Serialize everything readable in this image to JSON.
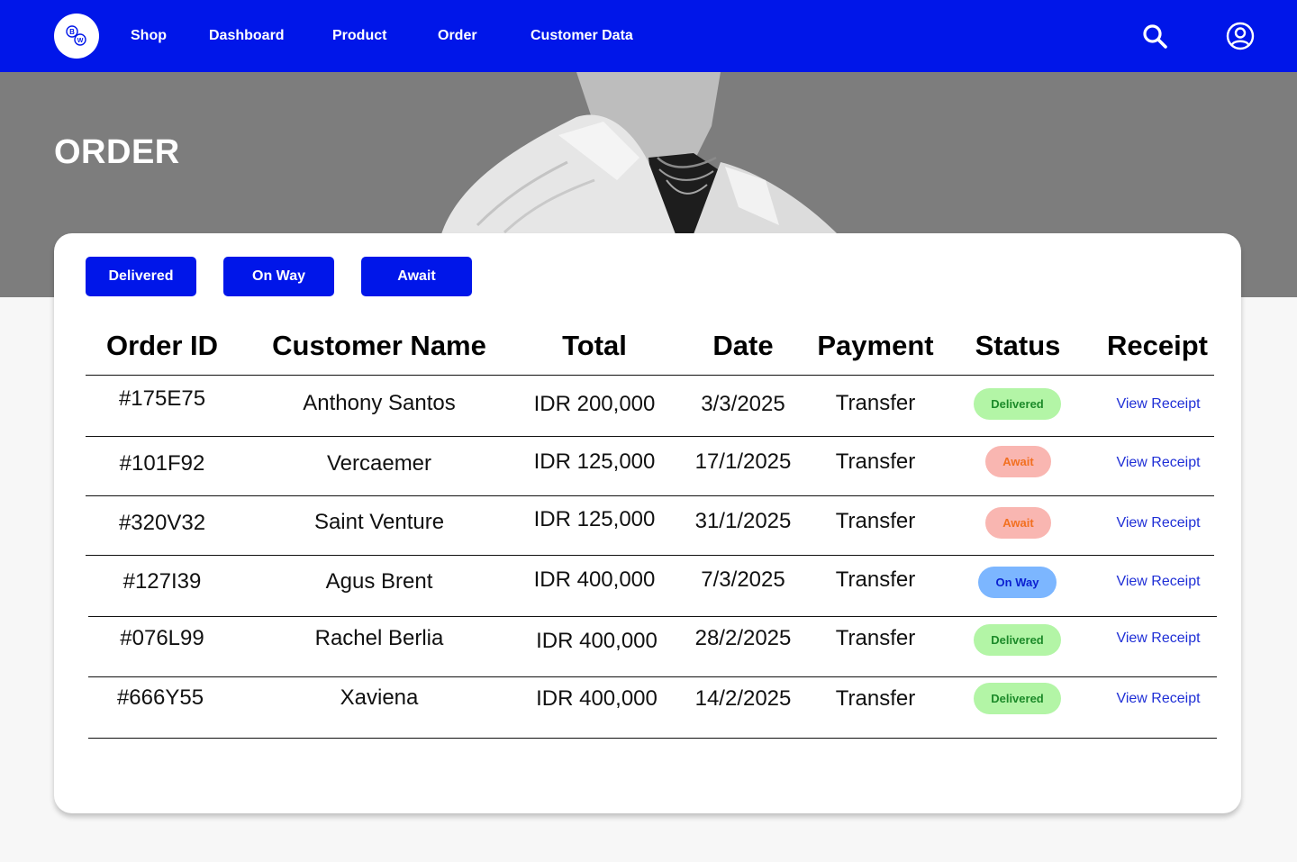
{
  "nav": {
    "links": [
      "Shop",
      "Dashboard",
      "Product",
      "Order",
      "Customer Data"
    ],
    "logo_text": "BW",
    "icons": [
      "search-icon",
      "user-icon"
    ]
  },
  "hero": {
    "title": "ORDER"
  },
  "filters": [
    "Delivered",
    "On Way",
    "Await"
  ],
  "table": {
    "headers": [
      "Order ID",
      "Customer Name",
      "Total",
      "Date",
      "Payment",
      "Status",
      "Receipt"
    ],
    "rows": [
      {
        "id": "#175E75",
        "name": "Anthony Santos",
        "total": "IDR 200,000",
        "date": "3/3/2025",
        "payment": "Transfer",
        "status": "Delivered",
        "receipt": "View Receipt"
      },
      {
        "id": "#101F92",
        "name": "Vercaemer",
        "total": "IDR 125,000",
        "date": "17/1/2025",
        "payment": "Transfer",
        "status": "Await",
        "receipt": "View Receipt"
      },
      {
        "id": "#320V32",
        "name": "Saint Venture",
        "total": "IDR 125,000",
        "date": "31/1/2025",
        "payment": "Transfer",
        "status": "Await",
        "receipt": "View Receipt"
      },
      {
        "id": "#127I39",
        "name": "Agus Brent",
        "total": "IDR 400,000",
        "date": "7/3/2025",
        "payment": "Transfer",
        "status": "On Way",
        "receipt": "View Receipt"
      },
      {
        "id": "#076L99",
        "name": "Rachel Berlia",
        "total": "IDR 400,000",
        "date": "28/2/2025",
        "payment": "Transfer",
        "status": "Delivered",
        "receipt": "View Receipt"
      },
      {
        "id": "#666Y55",
        "name": "Xaviena",
        "total": "IDR 400,000",
        "date": "14/2/2025",
        "payment": "Transfer",
        "status": "Delivered",
        "receipt": "View Receipt"
      }
    ]
  },
  "colors": {
    "primary": "#0016e9",
    "delivered_bg": "#b3f5a6",
    "delivered_text": "#1c8a29",
    "await_bg": "#f9b6b1",
    "await_text": "#f27021",
    "onway_bg": "#7cb6ff",
    "onway_text": "#0a1fd1",
    "link": "#1f2fd6"
  }
}
